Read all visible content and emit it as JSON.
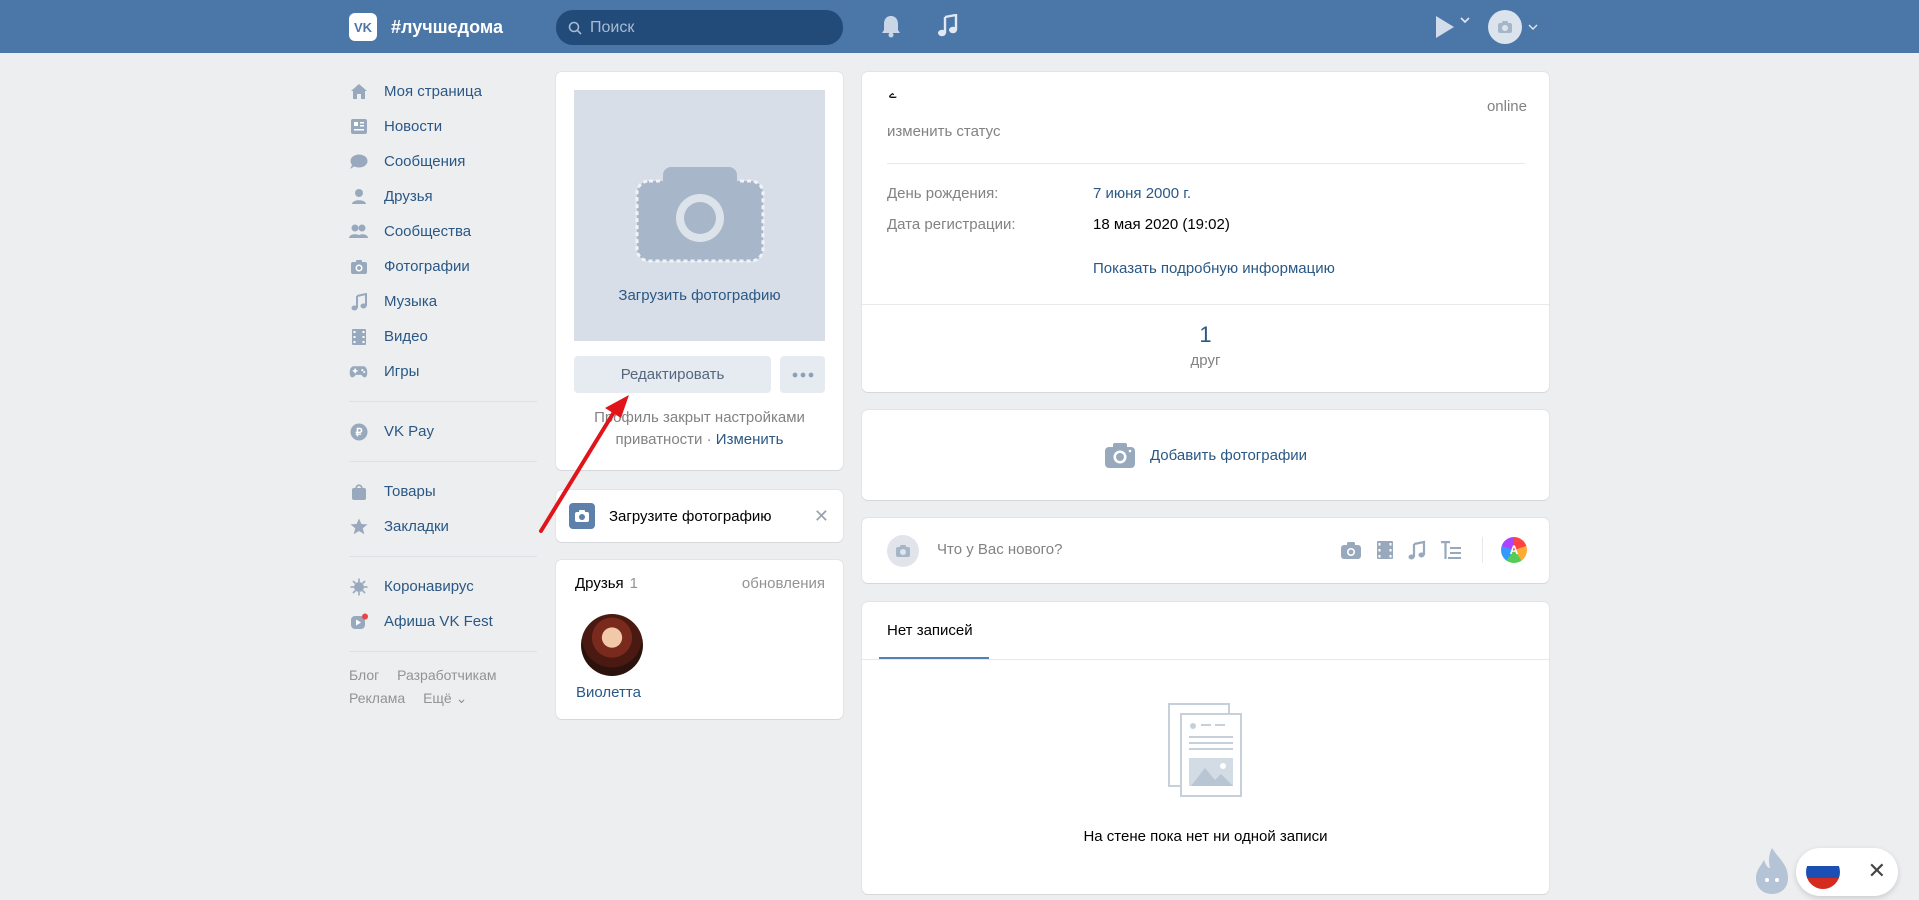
{
  "header": {
    "logo_text": "VK",
    "title": "#лучшедома",
    "search_placeholder": "Поиск"
  },
  "nav": {
    "main": [
      {
        "label": "Моя страница",
        "icon": "home-icon"
      },
      {
        "label": "Новости",
        "icon": "news-icon"
      },
      {
        "label": "Сообщения",
        "icon": "messages-icon"
      },
      {
        "label": "Друзья",
        "icon": "friend-icon"
      },
      {
        "label": "Сообщества",
        "icon": "communities-icon"
      },
      {
        "label": "Фотографии",
        "icon": "camera-icon"
      },
      {
        "label": "Музыка",
        "icon": "music-icon"
      },
      {
        "label": "Видео",
        "icon": "video-icon"
      },
      {
        "label": "Игры",
        "icon": "gamepad-icon"
      }
    ],
    "pay": "VK Pay",
    "shop": [
      "Товары",
      "Закладки"
    ],
    "extra": [
      "Коронавирус",
      "Афиша VK Fest"
    ],
    "footer": [
      "Блог",
      "Разработчикам",
      "Реклама",
      "Ещё ⌄"
    ]
  },
  "profile_photo": {
    "upload_label": "Загрузить фотографию",
    "edit_button": "Редактировать",
    "more_button": "•••",
    "privacy_text": "Профиль закрыт настройками приватности",
    "privacy_sep": " · ",
    "privacy_link": "Изменить"
  },
  "upload_prompt": {
    "text": "Загрузите фотографию",
    "close": "✕"
  },
  "friends": {
    "title": "Друзья",
    "count": "1",
    "updates": "обновления",
    "items": [
      {
        "name": "Виолетта"
      }
    ]
  },
  "info": {
    "status_glyph": "ے",
    "change_status": "изменить статус",
    "online": "online",
    "rows": [
      {
        "key": "День рождения:",
        "value": "7 июня 2000 г."
      },
      {
        "key": "Дата регистрации:",
        "value": "18 мая 2020 (19:02)"
      }
    ],
    "show_more": "Показать подробную информацию",
    "counter_num": "1",
    "counter_label": "друг"
  },
  "add_photos": "Добавить фотографии",
  "post": {
    "placeholder": "Что у Вас нового?",
    "palette_letter": "A"
  },
  "wall": {
    "tab": "Нет записей",
    "empty": "На стене пока нет ни одной записи"
  },
  "colors": {
    "header": "#4a76a8",
    "link": "#2a5885",
    "background": "#edeef0",
    "arrow": "#e0151b"
  }
}
